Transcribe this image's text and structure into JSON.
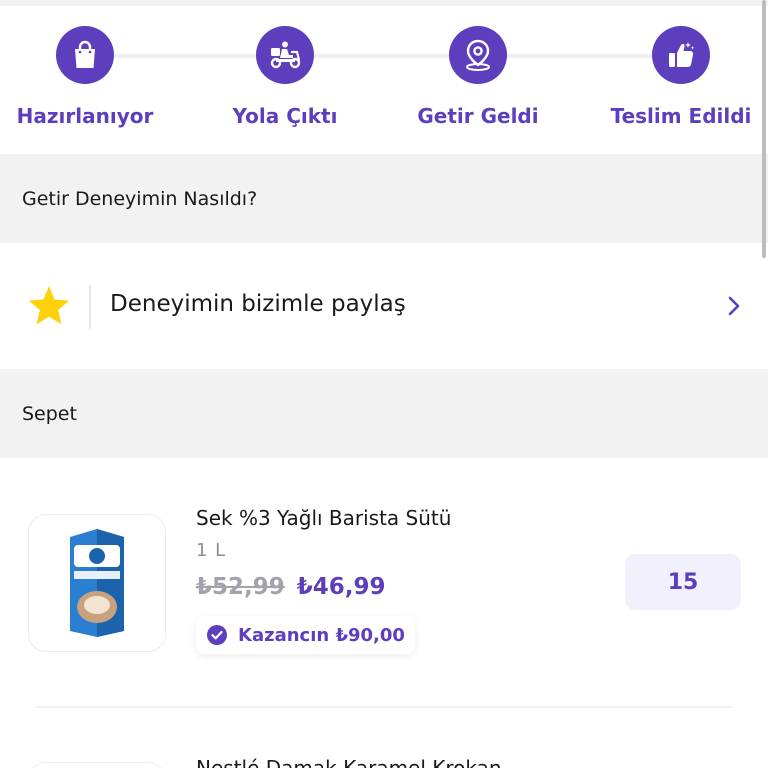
{
  "status_steps": [
    {
      "label": "Hazırlanıyor",
      "icon": "shopping-bag-icon"
    },
    {
      "label": "Yola Çıktı",
      "icon": "courier-scooter-icon"
    },
    {
      "label": "Getir Geldi",
      "icon": "location-pin-icon"
    },
    {
      "label": "Teslim Edildi",
      "icon": "thumbs-up-icon"
    }
  ],
  "experience": {
    "title": "Getir Deneyimin Nasıldı?",
    "prompt": "Deneyimin bizimle paylaş",
    "star_icon": "star-icon",
    "chevron_icon": "chevron-right-icon"
  },
  "cart": {
    "title": "Sepet",
    "items": [
      {
        "name": "Sek %3 Yağlı Barista Sütü",
        "unit": "1 L",
        "old_price": "₺52,99",
        "price": "₺46,99",
        "savings": "Kazancın ₺90,00",
        "quantity": "15"
      },
      {
        "name": "Nestlé Damak Karamel Krokan"
      }
    ]
  },
  "colors": {
    "brand": "#5d3ebc",
    "star": "#ffd10d",
    "section_bg": "#f2f2f2",
    "quantity_bg": "#f3f0fe"
  }
}
